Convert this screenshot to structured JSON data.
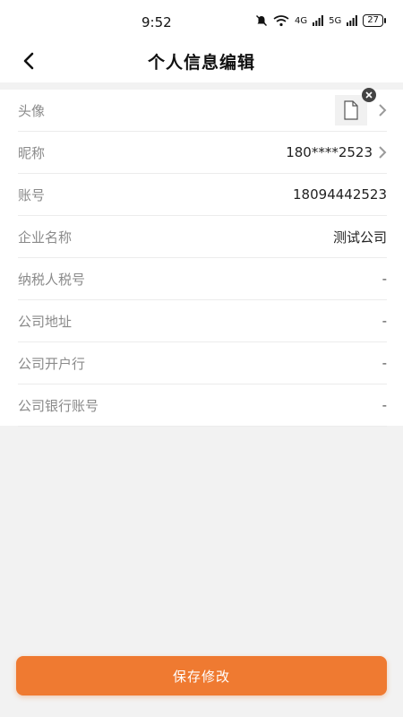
{
  "status_bar": {
    "time": "9:52",
    "network_a": "4G",
    "network_b": "5G",
    "battery": "27"
  },
  "header": {
    "title": "个人信息编辑"
  },
  "fields": [
    {
      "label": "头像",
      "value": ""
    },
    {
      "label": "昵称",
      "value": "180****2523"
    },
    {
      "label": "账号",
      "value": "18094442523"
    },
    {
      "label": "企业名称",
      "value": "测试公司"
    },
    {
      "label": "纳税人税号",
      "value": "-"
    },
    {
      "label": "公司地址",
      "value": "-"
    },
    {
      "label": "公司开户行",
      "value": "-"
    },
    {
      "label": "公司银行账号",
      "value": "-"
    }
  ],
  "footer": {
    "save_label": "保存修改"
  },
  "colors": {
    "accent": "#ef7a31",
    "label": "#8a8a8a",
    "background": "#f2f2f2"
  }
}
